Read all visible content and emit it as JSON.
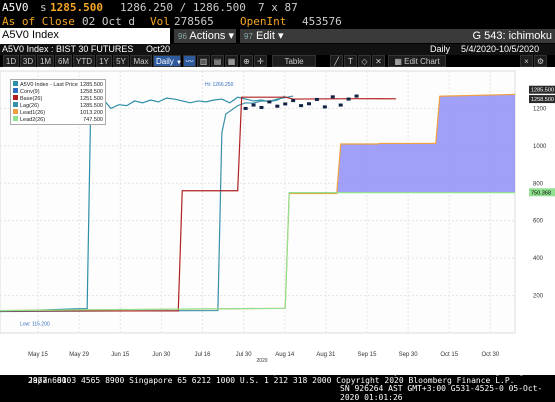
{
  "header": {
    "ticker": "A5V0",
    "last_prefix": "s",
    "last_price": "1285.500",
    "bid_ask": "1286.250 / 1286.500",
    "size": "7 x 87",
    "as_of_label": "As of Close",
    "as_of_date": "02 Oct d",
    "vol_label": "Vol",
    "vol_value": "278565",
    "openint_label": "OpenInt",
    "openint_value": "453576"
  },
  "toolbar": {
    "security": "A5V0 Index",
    "actions_num": "96",
    "actions_label": "Actions",
    "edit_num": "97",
    "edit_label": "Edit",
    "page_label": "G 543: ichimoku",
    "description": "A5V0 Index : BIST 30 FUTURES",
    "month": "Oct20",
    "period": "Daily",
    "date_range": "5/4/2020-10/5/2020",
    "ranges": [
      "1D",
      "3D",
      "1M",
      "6M",
      "YTD",
      "1Y",
      "5Y",
      "Max"
    ],
    "freq": "Daily",
    "table_label": "Table",
    "edit_chart_label": "Edit Chart"
  },
  "colors": {
    "price": "#2e8fa8",
    "conv": "#2e6fbf",
    "base": "#b02020",
    "lag": "#3a8fa8",
    "lead1": "#f0a040",
    "lead2": "#8fe08f",
    "cloud": "#8f8ff8"
  },
  "legend": [
    {
      "label": "A5V0 Index - Last Price",
      "value": "1285.500",
      "color": "#2e8fa8"
    },
    {
      "label": "Conv(9)",
      "value": "1258.500",
      "color": "#2e6fbf"
    },
    {
      "label": "Base(26)",
      "value": "1251.500",
      "color": "#b02020"
    },
    {
      "label": "Lag(26)",
      "value": "1285.500",
      "color": "#3a8fa8"
    },
    {
      "label": "Lead1(26)",
      "value": "1013.200",
      "color": "#f0a040"
    },
    {
      "label": "Lead2(26)",
      "value": "747.500",
      "color": "#8fe08f"
    }
  ],
  "annotations": {
    "hi": "Hi: 1266.250",
    "low": "Low: 115.200",
    "tag_upper": "1285.500",
    "tag_lower": "1258.500",
    "tag_lead2": "750.368"
  },
  "chart_data": {
    "type": "line",
    "title": "",
    "xlabel": "2020",
    "ylabel": "",
    "ylim": [
      0,
      1400
    ],
    "yticks": [
      "1200",
      "1000",
      "800",
      "600",
      "400",
      "200"
    ],
    "xticks": [
      "May 15",
      "May 29",
      "Jun 15",
      "Jun 30",
      "Jul 16",
      "Jul 30",
      "Aug 14",
      "Aug 31",
      "Sep 15",
      "Sep 30",
      "Oct 15",
      "Oct 30"
    ],
    "x_index_range": [
      0,
      130
    ],
    "series": [
      {
        "name": "A5V0 Index - Last Price",
        "x": [
          0,
          20,
          22,
          23,
          24,
          26,
          28,
          30,
          32,
          34,
          36,
          38,
          40,
          42,
          44,
          46,
          48,
          50,
          52,
          54,
          56,
          58,
          60,
          62,
          64,
          66,
          68,
          70,
          72
        ],
        "values": [
          115,
          130,
          130,
          1340,
          1290,
          1250,
          1200,
          1220,
          1215,
          1240,
          1230,
          1245,
          1235,
          1255,
          1250,
          1240,
          1230,
          1240,
          1235,
          1245,
          1250,
          1230,
          1260,
          1250,
          1240,
          1245,
          1236,
          1245,
          1266
        ]
      },
      {
        "name": "Lag(26)",
        "x": [
          0,
          55,
          56,
          57,
          60,
          62,
          64,
          66,
          68,
          70,
          74
        ],
        "values": [
          115,
          120,
          1070,
          1170,
          1215,
          1230,
          1228,
          1240,
          1238,
          1250,
          1266
        ]
      },
      {
        "name": "Base(26)",
        "x": [
          0,
          45,
          46,
          60,
          61,
          72,
          74,
          90,
          100
        ],
        "values": [
          118,
          118,
          760,
          760,
          1260,
          1260,
          1250,
          1252,
          1251.5
        ]
      },
      {
        "name": "Lead1(26)",
        "x": [
          0,
          72,
          73,
          85,
          86,
          95,
          96,
          110,
          111,
          130
        ],
        "values": [
          120,
          132,
          745,
          745,
          1010,
          1010,
          1013,
          1013,
          1265,
          1275
        ]
      },
      {
        "name": "Lead2(26)",
        "x": [
          0,
          72,
          73,
          130
        ],
        "values": [
          120,
          132,
          750,
          750
        ]
      }
    ],
    "cloud": {
      "x": [
        73,
        85,
        86,
        95,
        96,
        110,
        111,
        130
      ],
      "upper": [
        745,
        745,
        1010,
        1010,
        1013,
        1013,
        1265,
        1275
      ],
      "lower": [
        750,
        750,
        750,
        750,
        750,
        750,
        750,
        750
      ]
    },
    "candles": {
      "x": [
        62,
        64,
        66,
        68,
        70,
        72,
        74,
        76,
        78,
        80,
        82,
        84,
        86,
        88,
        90
      ],
      "values": [
        1200,
        1218,
        1205,
        1235,
        1212,
        1224,
        1242,
        1215,
        1225,
        1248,
        1208,
        1262,
        1218,
        1250,
        1266
      ]
    }
  },
  "footer": {
    "line1": "Australia 61 2 9777 8600 Brazil 5511 2395 9000 Europe 44 20 7330 7500 Germany 49 69 9204 1210 Hong Kong 852 2977 6000",
    "line2": "Japan 81 3 4565 8900          Singapore 65 6212 1000        U.S. 1 212 318 2000        Copyright 2020 Bloomberg Finance L.P.",
    "line3": "SN 926264 AST  GMT+3:00 G531-4525-0 05-Oct-2020 01:01:26"
  }
}
